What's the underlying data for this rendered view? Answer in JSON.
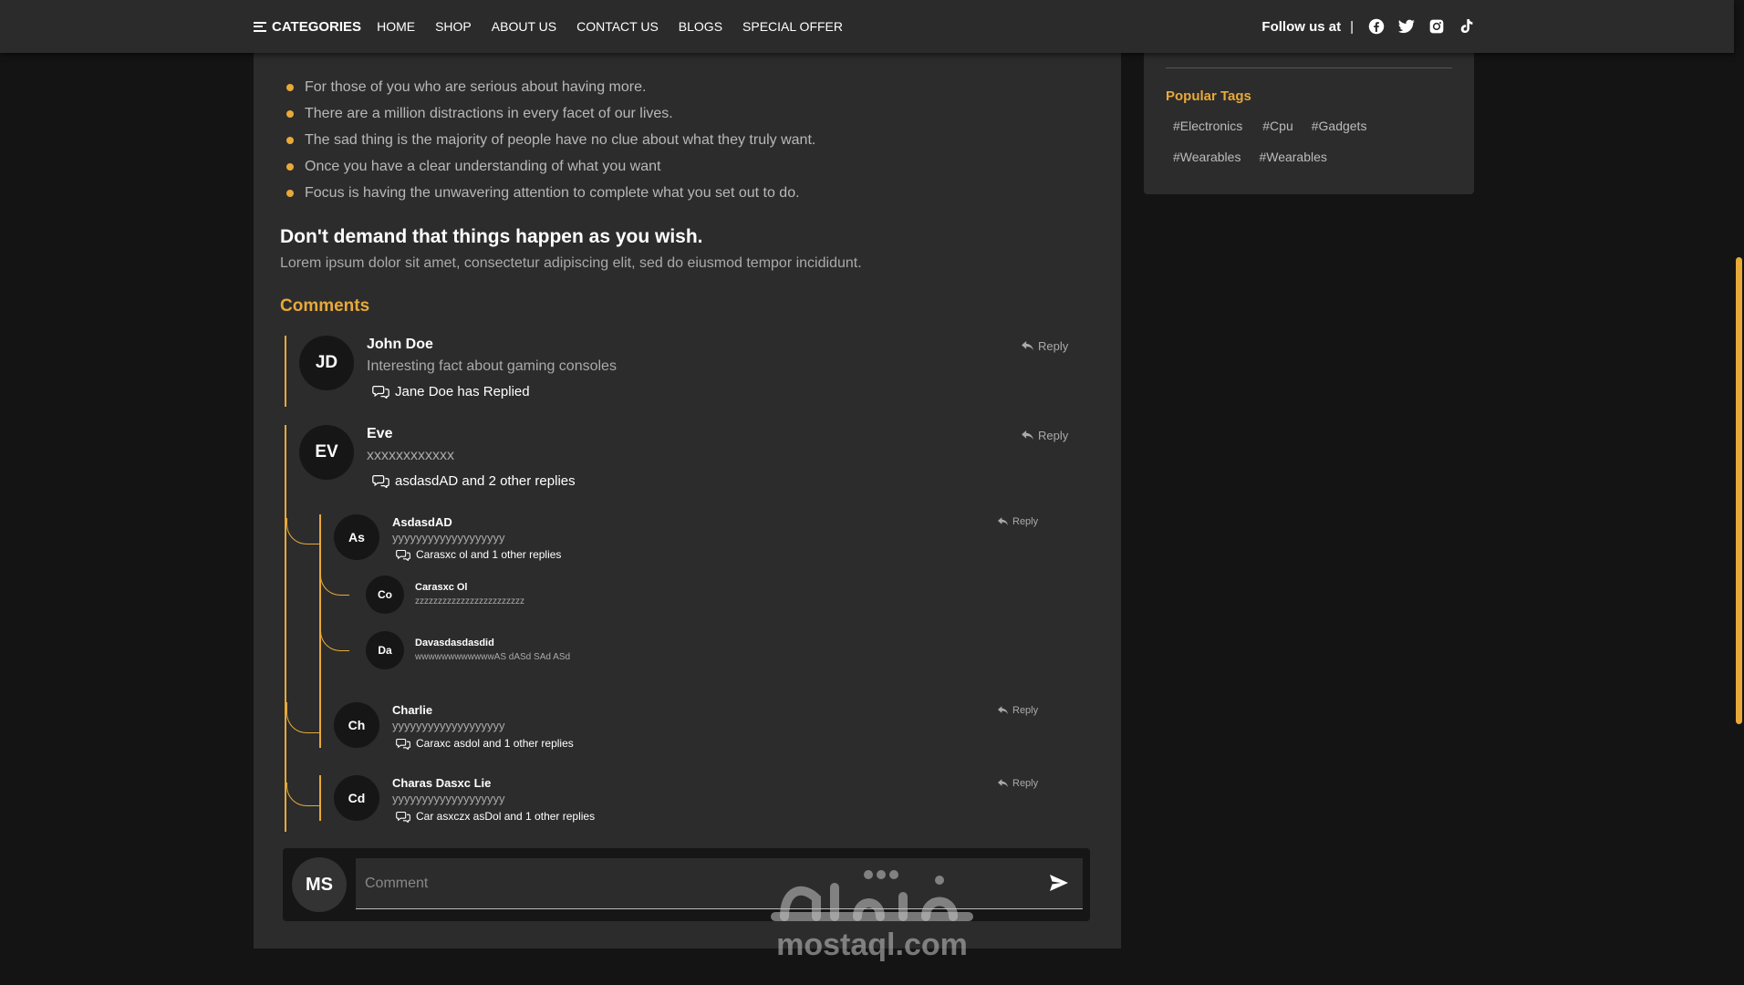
{
  "navbar": {
    "categories_label": "CATEGORIES",
    "links": [
      "HOME",
      "SHOP",
      "ABOUT US",
      "CONTACT US",
      "BLOGS",
      "SPECIAL OFFER"
    ],
    "follow_label": "Follow us at",
    "separator": "|",
    "social_icons": [
      "facebook-icon",
      "twitter-icon",
      "instagram-icon",
      "tiktok-icon"
    ]
  },
  "article": {
    "bullets": [
      "For those of you who are serious about having more.",
      "There are a million distractions in every facet of our lives.",
      "The sad thing is the majority of people have no clue about what they truly want.",
      "Once you have a clear understanding of what you want",
      "Focus is having the unwavering attention to complete what you set out to do."
    ],
    "subheading": "Don't demand that things happen as you wish.",
    "paragraph": "Lorem ipsum dolor sit amet, consectetur adipiscing elit, sed do eiusmod tempor incididunt."
  },
  "comments": {
    "title": "Comments",
    "reply_label": "Reply",
    "items": [
      {
        "initials": "JD",
        "name": "John Doe",
        "text": "Interesting fact about gaming consoles",
        "replies_text": "Jane Doe has Replied"
      },
      {
        "initials": "EV",
        "name": "Eve",
        "text": "xxxxxxxxxxxx",
        "replies_text": "asdasdAD and 2 other replies",
        "children": [
          {
            "initials": "As",
            "name": "AsdasdAD",
            "text": "yyyyyyyyyyyyyyyyyyy",
            "replies_text": "Carasxc ol and 1 other replies",
            "children": [
              {
                "initials": "Co",
                "name": "Carasxc Ol",
                "text": "zzzzzzzzzzzzzzzzzzzzzzzz"
              },
              {
                "initials": "Da",
                "name": "Davasdasdasdid",
                "text": "wwwwwwwwwwwwAS dASd SAd ASd"
              }
            ]
          },
          {
            "initials": "Ch",
            "name": "Charlie",
            "text": "yyyyyyyyyyyyyyyyyyy",
            "replies_text": "Caraxc asdol and 1 other replies"
          },
          {
            "initials": "Cd",
            "name": "Charas Dasxc Lie",
            "text": "yyyyyyyyyyyyyyyyyyy",
            "replies_text": "Car asxczx asDol and 1 other replies"
          }
        ]
      }
    ],
    "input": {
      "avatar_initials": "MS",
      "placeholder": "Comment"
    }
  },
  "sidebar": {
    "tags_title": "Popular Tags",
    "tags": [
      "#Electronics",
      "#Cpu",
      "#Gadgets",
      "#Wearables",
      "#Wearables"
    ]
  },
  "watermark": {
    "url": "mostaql.com"
  },
  "colors": {
    "accent": "#e8a93a",
    "panel": "#2c2c2c",
    "background": "#141414"
  }
}
